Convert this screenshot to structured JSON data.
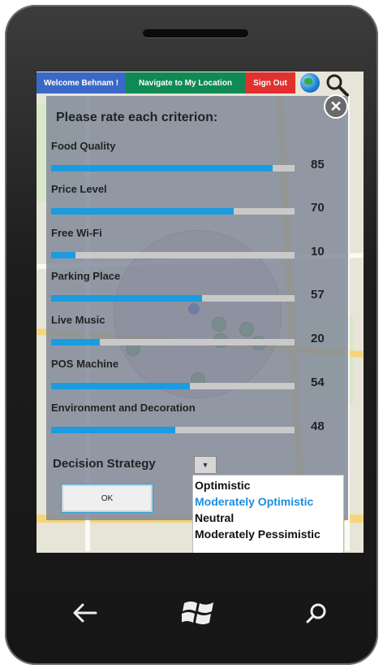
{
  "topbar": {
    "welcome": "Welcome Behnam !",
    "navigate": "Navigate to My Location",
    "signout": "Sign Out"
  },
  "panel": {
    "title": "Please rate each criterion:",
    "criteria": [
      {
        "label": "Food Quality",
        "value": "85",
        "fraction": 0.91
      },
      {
        "label": "Price Level",
        "value": "70",
        "fraction": 0.75
      },
      {
        "label": "Free Wi-Fi",
        "value": "10",
        "fraction": 0.1
      },
      {
        "label": "Parking Place",
        "value": "57",
        "fraction": 0.62
      },
      {
        "label": "Live Music",
        "value": "20",
        "fraction": 0.2
      },
      {
        "label": "POS Machine",
        "value": "54",
        "fraction": 0.57
      },
      {
        "label": "Environment and Decoration",
        "value": "48",
        "fraction": 0.51
      }
    ],
    "strategy_label": "Decision Strategy",
    "ok_label": "OK",
    "strategy_options": [
      "Optimistic",
      "Moderately Optimistic",
      "Neutral",
      "Moderately Pessimistic"
    ],
    "selected_option": "Moderately Optimistic"
  },
  "colors": {
    "accent": "#1b9ce0",
    "welcome_bg": "#3a68c7",
    "navigate_bg": "#108a54",
    "signout_bg": "#e0312e"
  },
  "icons": [
    "globe-icon",
    "magnifier-icon",
    "close-icon",
    "back-icon",
    "windows-icon",
    "search-icon"
  ]
}
